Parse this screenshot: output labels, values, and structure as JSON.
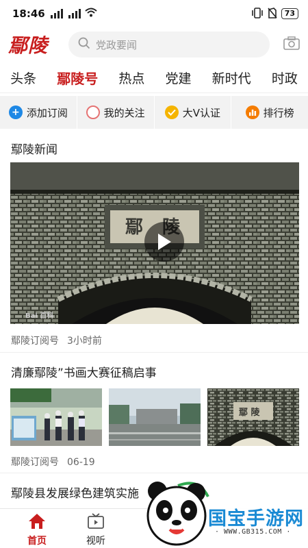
{
  "status": {
    "time": "18:46",
    "battery": "73"
  },
  "header": {
    "logo": "鄢陵",
    "search_placeholder": "党政要闻"
  },
  "tabs": [
    {
      "label": "头条"
    },
    {
      "label": "鄢陵号",
      "active": true
    },
    {
      "label": "热点"
    },
    {
      "label": "党建"
    },
    {
      "label": "新时代"
    },
    {
      "label": "时政"
    }
  ],
  "actions": [
    {
      "label": "添加订阅",
      "icon": "plus-circle-icon",
      "color": "#1e88e5"
    },
    {
      "label": "我的关注",
      "icon": "ring-icon",
      "color": "#e57373"
    },
    {
      "label": "大V认证",
      "icon": "check-circle-icon",
      "color": "#f5b400"
    },
    {
      "label": "排行榜",
      "icon": "bar-chart-icon",
      "color": "#f57c00"
    }
  ],
  "feed": [
    {
      "title": "鄢陵新闻",
      "source": "鄢陵订阅号",
      "time": "3小时前",
      "media": "video"
    },
    {
      "title": "清廉鄢陵”书画大赛征稿启事",
      "source": "鄢陵订阅号",
      "time": "06-19",
      "media": "three-images"
    },
    {
      "title": "鄢陵县发展绿色建筑实施"
    }
  ],
  "video": {
    "watermark": "Bai 百科"
  },
  "bottom_nav": [
    {
      "label": "首页",
      "icon": "home-icon",
      "active": true
    },
    {
      "label": "视听",
      "icon": "tv-icon"
    }
  ],
  "ad": {
    "brand": "国宝手游网",
    "url": "· WWW.GB315.COM ·"
  },
  "colors": {
    "brand_red": "#c81e1e",
    "action_bg": "#f2f2f2"
  }
}
